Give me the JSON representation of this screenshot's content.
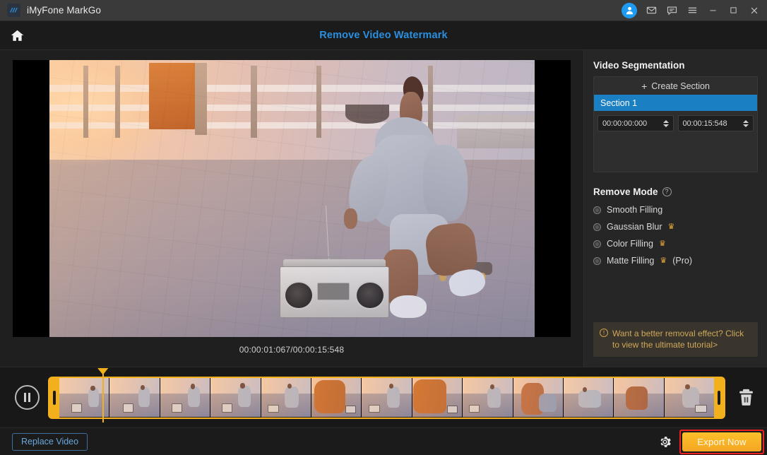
{
  "titlebar": {
    "app_name": "iMyFone MarkGo",
    "logo_icon": "markgo-logo-icon",
    "account_icon": "user-account-icon",
    "mail_icon": "mail-icon",
    "feedback_icon": "feedback-icon",
    "menu_icon": "hamburger-menu-icon",
    "minimize_icon": "minimize-icon",
    "maximize_icon": "maximize-icon",
    "close_icon": "close-icon"
  },
  "header": {
    "home_icon": "home-icon",
    "title": "Remove Video Watermark"
  },
  "preview": {
    "time_display": "00:00:01:067/00:00:15:548",
    "current_time": "00:00:01:067",
    "total_time": "00:00:15:548"
  },
  "segmentation": {
    "heading": "Video Segmentation",
    "create_label": "Create Section",
    "create_icon": "plus-icon",
    "sections": [
      {
        "name": "Section 1",
        "start": "00:00:00:000",
        "end": "00:00:15:548",
        "selected": true
      }
    ],
    "accent_color": "#1b7fc4"
  },
  "remove_mode": {
    "heading": "Remove Mode",
    "help_icon": "question-mark-icon",
    "options": [
      {
        "label": "Smooth Filling",
        "pro": false,
        "crown": false,
        "selected": false
      },
      {
        "label": "Gaussian Blur",
        "pro": false,
        "crown": true,
        "selected": false
      },
      {
        "label": "Color Filling",
        "pro": false,
        "crown": true,
        "selected": false
      },
      {
        "label": "Matte Filling",
        "pro": true,
        "pro_text": "(Pro)",
        "crown": true,
        "selected": false
      }
    ],
    "crown_icon": "crown-icon",
    "crown_color": "#e7a93a"
  },
  "tutorial": {
    "icon": "info-icon",
    "text": "Want a better removal effect? Click to view the ultimate tutorial>",
    "text_color": "#cfa85a",
    "background": "#3a352c"
  },
  "timeline": {
    "play_icon": "pause-icon",
    "delete_icon": "trash-icon",
    "playhead_position_percent": 8,
    "clip_border_color": "#f2b01c",
    "frame_count": 13
  },
  "bottom": {
    "replace_label": "Replace Video",
    "settings_icon": "gear-icon",
    "export_label": "Export Now",
    "export_color": "#f5a623",
    "export_highlight_color": "#ef2020"
  }
}
